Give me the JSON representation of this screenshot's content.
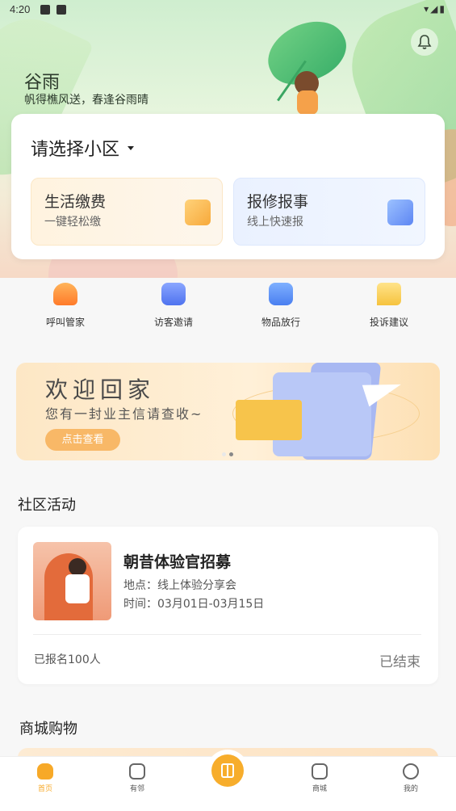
{
  "status_bar": {
    "time": "4:20",
    "right_icons": "▾◢▮"
  },
  "hero": {
    "title": "谷雨",
    "subtitle": "帆得樵风送，春逢谷雨晴"
  },
  "community": {
    "selector_label": "请选择小区",
    "tiles": [
      {
        "title": "生活缴费",
        "subtitle": "一键轻松缴",
        "icon": "wallet-icon"
      },
      {
        "title": "报修报事",
        "subtitle": "线上快速报",
        "icon": "repair-icon"
      }
    ]
  },
  "quick_actions": [
    {
      "label": "呼叫管家",
      "icon": "butler-icon"
    },
    {
      "label": "访客邀请",
      "icon": "visitor-icon"
    },
    {
      "label": "物品放行",
      "icon": "release-icon"
    },
    {
      "label": "投诉建议",
      "icon": "feedback-icon"
    }
  ],
  "banner": {
    "title": "欢迎回家",
    "subtitle": "您有一封业主信请查收~",
    "button": "点击查看"
  },
  "activities": {
    "section_title": "社区活动",
    "items": [
      {
        "title": "朝昔体验官招募",
        "location": "地点：线上体验分享会",
        "time": "时间：03月01日-03月15日",
        "signup": "已报名100人",
        "status": "已结束"
      }
    ]
  },
  "mall": {
    "section_title": "商城购物"
  },
  "tabs": [
    {
      "label": "首页",
      "icon": "home-icon",
      "active": true
    },
    {
      "label": "有邻",
      "icon": "neighbor-icon",
      "active": false
    },
    {
      "label": "",
      "icon": "center-icon",
      "active": false
    },
    {
      "label": "商城",
      "icon": "bag-icon",
      "active": false
    },
    {
      "label": "我的",
      "icon": "smile-icon",
      "active": false
    }
  ],
  "colors": {
    "accent": "#f7a928",
    "pay_tile": "#fff3df",
    "repair_tile": "#eaf1ff"
  }
}
